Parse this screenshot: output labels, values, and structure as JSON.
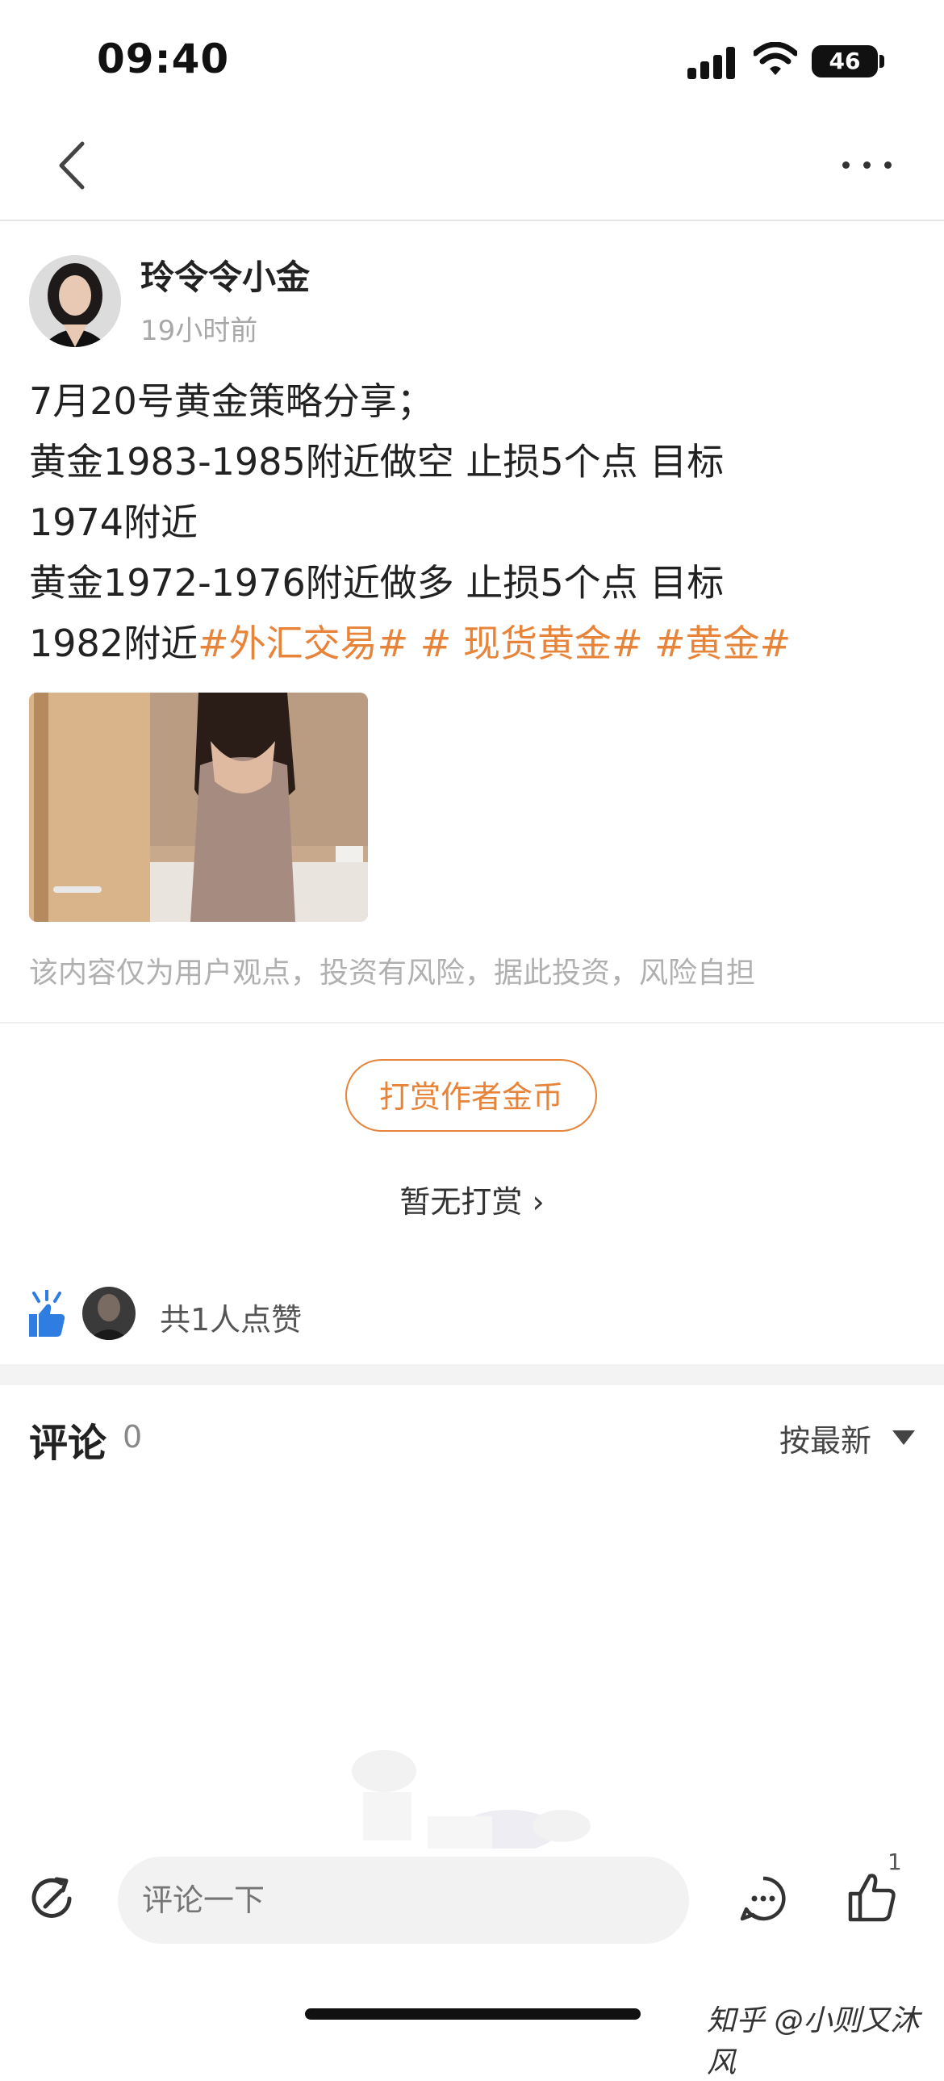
{
  "status_bar": {
    "time": "09:40",
    "battery": "46"
  },
  "nav": {
    "back_icon": "chevron-left-icon",
    "more_icon": "more-dots-icon"
  },
  "author": {
    "name": "玲令令小金",
    "time": "19小时前"
  },
  "post": {
    "lines": [
      "7月20号黄金策略分享；",
      "黄金1983-1985附近做空 止损5个点 目标",
      "1974附近",
      "黄金1972-1976附近做多 止损5个点 目标",
      "1982附近"
    ],
    "tags": [
      "#外汇交易#",
      "# 现货黄金#",
      "#黄金#"
    ]
  },
  "disclaimer": "该内容仅为用户观点，投资有风险，据此投资，风险自担",
  "reward": {
    "button": "打赏作者金币",
    "status": "暂无打赏 ›"
  },
  "likes": {
    "summary": "共1人点赞"
  },
  "comments": {
    "title": "评论",
    "count": "0",
    "sort": "按最新"
  },
  "bottom_bar": {
    "placeholder": "评论一下",
    "like_count": "1"
  },
  "watermark": "知乎 @小则又沐风",
  "colors": {
    "accent": "#e8843a",
    "like_blue": "#2f7de1"
  }
}
